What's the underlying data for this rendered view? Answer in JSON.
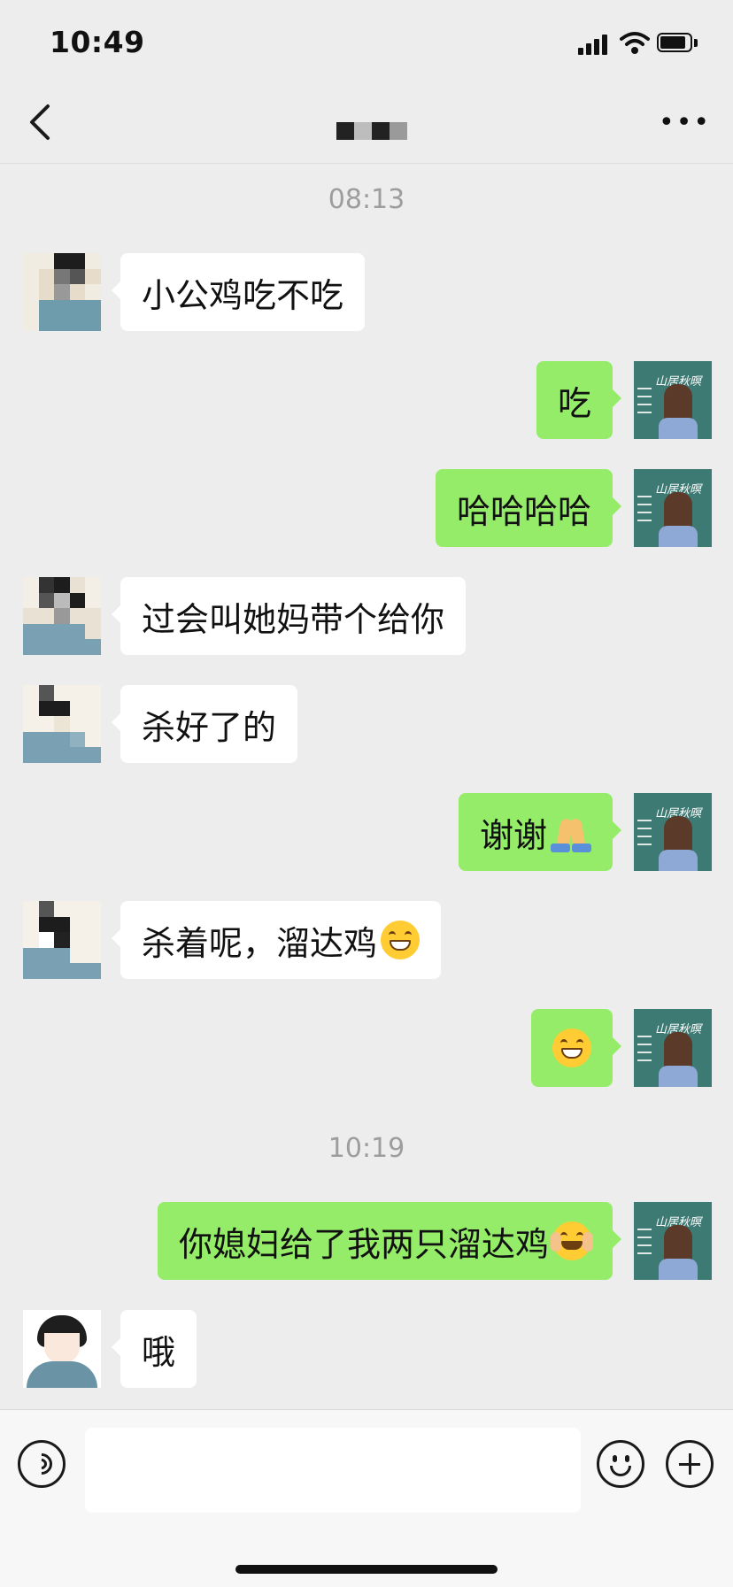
{
  "status_bar": {
    "time": "10:49"
  },
  "nav": {
    "title_redacted": true
  },
  "timestamps": [
    "08:13",
    "10:19"
  ],
  "messages": [
    {
      "side": "left",
      "text": "小公鸡吃不吃",
      "emoji": ""
    },
    {
      "side": "right",
      "text": "吃",
      "emoji": ""
    },
    {
      "side": "right",
      "text": "哈哈哈哈",
      "emoji": ""
    },
    {
      "side": "left",
      "text": "过会叫她妈带个给你",
      "emoji": ""
    },
    {
      "side": "left",
      "text": "杀好了的",
      "emoji": ""
    },
    {
      "side": "right",
      "text": "谢谢",
      "emoji": "folded-hands-emoji"
    },
    {
      "side": "left",
      "text": "杀着呢，溜达鸡",
      "emoji": "grinning-emoji"
    },
    {
      "side": "right",
      "text": "",
      "emoji": "grinning-emoji"
    },
    {
      "side": "right",
      "text": "你媳妇给了我两只溜达鸡",
      "emoji": "sweat-smile-emoji"
    },
    {
      "side": "left",
      "text": "哦",
      "emoji": ""
    }
  ],
  "input_bar": {
    "input_value": "",
    "icons": [
      "voice-icon",
      "emoji-icon",
      "add-icon"
    ]
  },
  "colors": {
    "background": "#ededed",
    "my_bubble": "#95ec69",
    "their_bubble": "#ffffff"
  }
}
